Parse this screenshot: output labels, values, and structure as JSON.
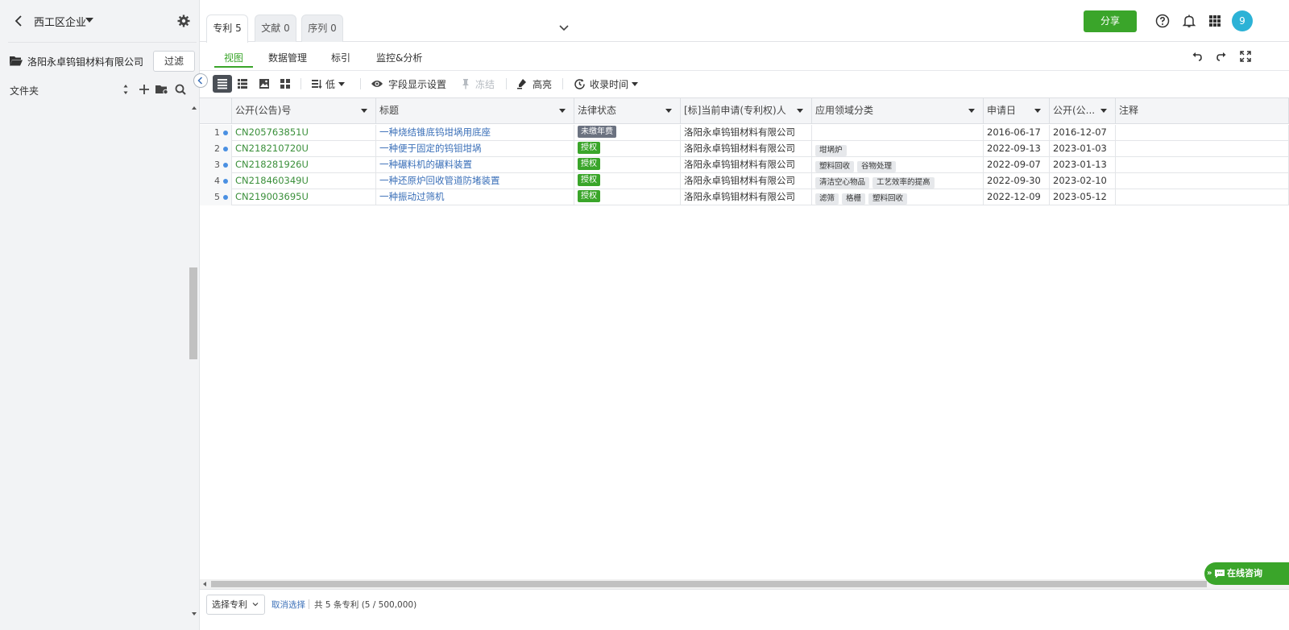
{
  "sidebar": {
    "title": "西工区企业",
    "company": "洛阳永卓钨钼材料有限公司",
    "filter_label": "过滤",
    "folder_label": "文件夹"
  },
  "top_tabs": [
    {
      "label": "专利 5"
    },
    {
      "label": "文献 0"
    },
    {
      "label": "序列 0"
    }
  ],
  "share_label": "分享",
  "avatar_text": "9",
  "sub_tabs": [
    {
      "label": "视图"
    },
    {
      "label": "数据管理"
    },
    {
      "label": "标引"
    },
    {
      "label": "监控&分析"
    }
  ],
  "toolbar": {
    "density": "低",
    "fields": "字段显示设置",
    "freeze": "冻结",
    "highlight": "高亮",
    "sort": "收录时间"
  },
  "columns": [
    "公开(公告)号",
    "标题",
    "法律状态",
    "[标]当前申请(专利权)人",
    "应用领域分类",
    "申请日",
    "公开(公...",
    "注释"
  ],
  "rows": [
    {
      "num": "1",
      "pn": "CN205763851U",
      "title": "一种烧结锥底钨坩埚用底座",
      "status": "未缴年费",
      "applicant": "洛阳永卓钨钼材料有限公司",
      "tags": [],
      "app_date": "2016-06-17",
      "pub_date": "2016-12-07"
    },
    {
      "num": "2",
      "pn": "CN218210720U",
      "title": "一种便于固定的钨钼坩埚",
      "status": "授权",
      "applicant": "洛阳永卓钨钼材料有限公司",
      "tags": [
        "坩埚炉"
      ],
      "app_date": "2022-09-13",
      "pub_date": "2023-01-03"
    },
    {
      "num": "3",
      "pn": "CN218281926U",
      "title": "一种碾料机的碾料装置",
      "status": "授权",
      "applicant": "洛阳永卓钨钼材料有限公司",
      "tags": [
        "塑料回收",
        "谷物处理"
      ],
      "app_date": "2022-09-07",
      "pub_date": "2023-01-13"
    },
    {
      "num": "4",
      "pn": "CN218460349U",
      "title": "一种还原炉回收管道防堵装置",
      "status": "授权",
      "applicant": "洛阳永卓钨钼材料有限公司",
      "tags": [
        "清洁空心物品",
        "工艺效率的提高"
      ],
      "app_date": "2022-09-30",
      "pub_date": "2023-02-10"
    },
    {
      "num": "5",
      "pn": "CN219003695U",
      "title": "一种振动过筛机",
      "status": "授权",
      "applicant": "洛阳永卓钨钼材料有限公司",
      "tags": [
        "滤筛",
        "格栅",
        "塑料回收"
      ],
      "app_date": "2022-12-09",
      "pub_date": "2023-05-12"
    }
  ],
  "status_colors": {
    "未缴年费": "#6b7280",
    "授权": "#3aa52a"
  },
  "footer": {
    "select_label": "选择专利",
    "cancel_label": "取消选择",
    "count_text": "共 5 条专利 (5 / 500,000)"
  },
  "chat_label": "在线咨询",
  "colors": {
    "accent": "#3aa52a",
    "link": "#3a6fb8",
    "patent_number": "#3a8f3a",
    "avatar": "#2cb2d6"
  }
}
